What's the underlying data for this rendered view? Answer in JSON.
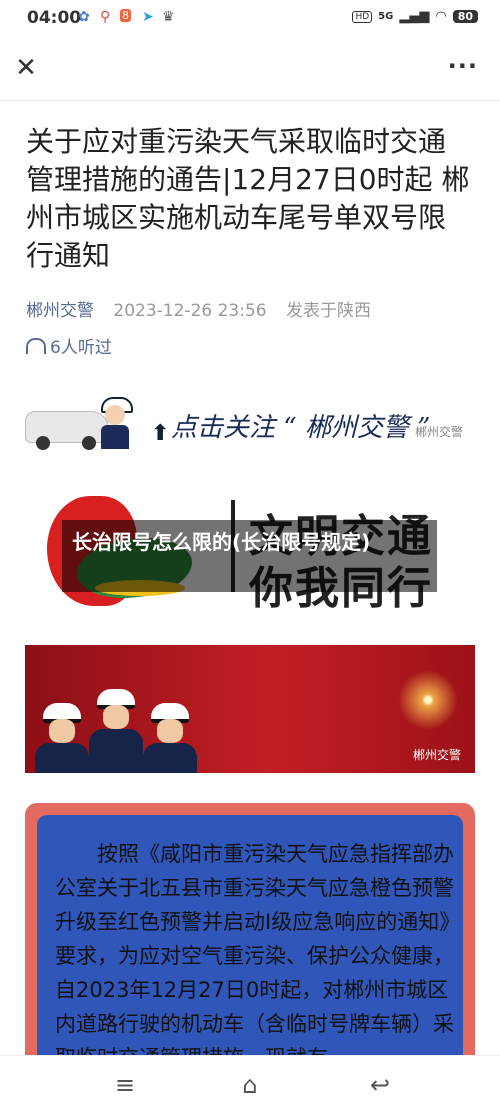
{
  "status_bar": {
    "time": "04:00",
    "network": "5G",
    "battery": "80"
  },
  "toolbar": {
    "close_icon": "close-icon",
    "more_icon": "more-icon"
  },
  "article": {
    "title": "关于应对重污染天气采取临时交通管理措施的通告|12月27日0时起 郴州市城区实施机动车尾号单双号限行通知",
    "author": "郴州交警",
    "date": "2023-12-26 23:56",
    "location": "发表于陕西",
    "listeners": "6人听过"
  },
  "banner_follow": {
    "text": "点击关注 “ 郴州交警 ”",
    "watermark": "郴州交警"
  },
  "civilization": {
    "line1": "文明交通",
    "line2": "你我同行"
  },
  "overlay_title": "长治限号怎么限的(长治限号规定)",
  "banner_police": {
    "watermark": "郴州交警"
  },
  "notice_text": "按照《咸阳市重污染天气应急指挥部办公室关于北五县市重污染天气应急橙色预警升级至红色预警并启动I级应急响应的通知》要求，为应对空气重污染、保护公众健康，自2023年12月27日0时起，对郴州市城区内道路行驶的机动车（含临时号牌车辆）采取临时交通管理措施，现就有",
  "nav": {
    "menu": "menu-icon",
    "home": "home-icon",
    "back": "back-icon"
  }
}
